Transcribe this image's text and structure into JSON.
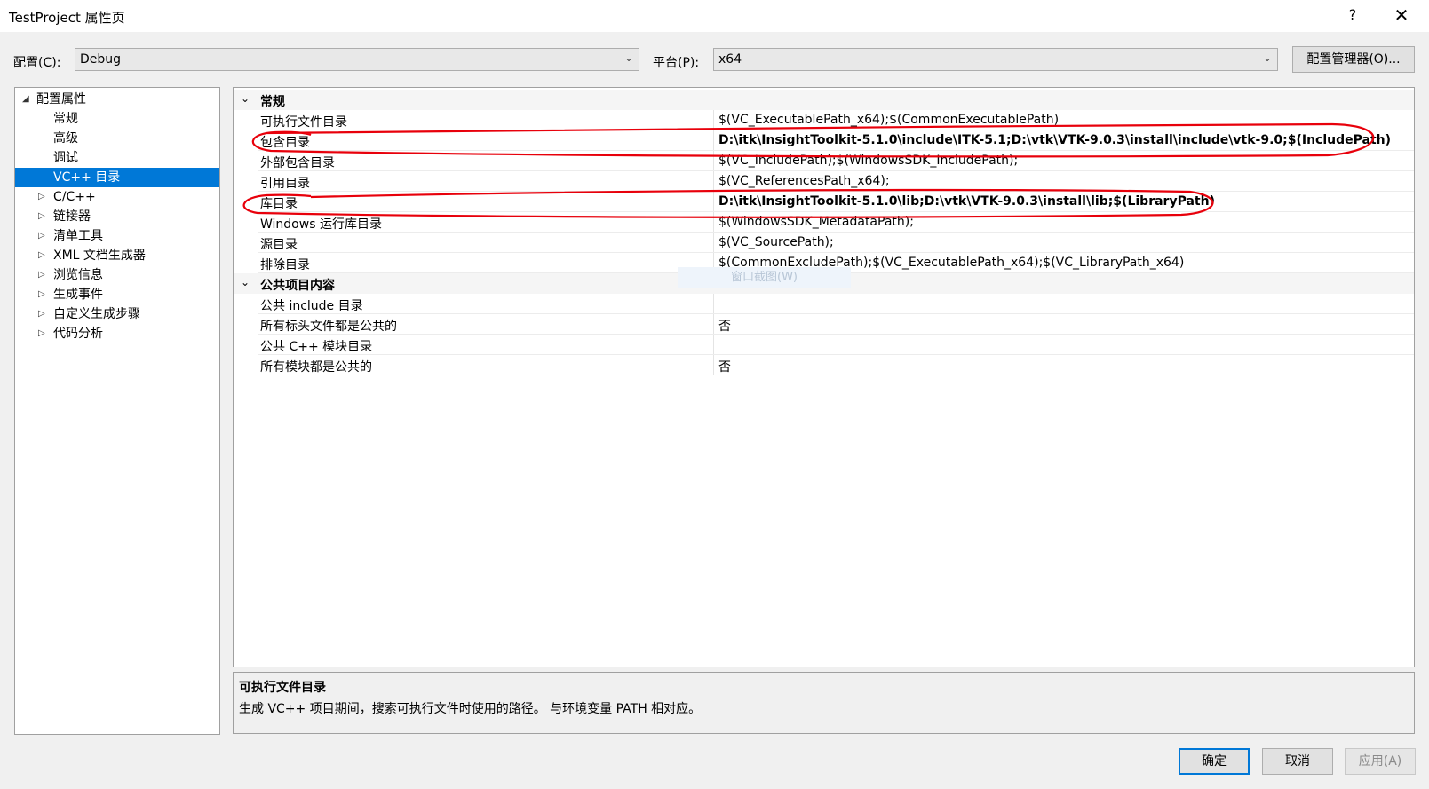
{
  "window": {
    "title": "TestProject 属性页",
    "help": "?",
    "close": "✕"
  },
  "config": {
    "config_label": "配置(C):",
    "config_value": "Debug",
    "platform_label": "平台(P):",
    "platform_value": "x64",
    "manager_button": "配置管理器(O)..."
  },
  "tree": {
    "root": "配置属性",
    "items": [
      "常规",
      "高级",
      "调试",
      "VC++ 目录",
      "C/C++",
      "链接器",
      "清单工具",
      "XML 文档生成器",
      "浏览信息",
      "生成事件",
      "自定义生成步骤",
      "代码分析"
    ],
    "selected": "VC++ 目录"
  },
  "grid": {
    "cat1": "常规",
    "rows1": [
      {
        "name": "可执行文件目录",
        "value": "$(VC_ExecutablePath_x64);$(CommonExecutablePath)"
      },
      {
        "name": "包含目录",
        "value": "D:\\itk\\InsightToolkit-5.1.0\\include\\ITK-5.1;D:\\vtk\\VTK-9.0.3\\install\\include\\vtk-9.0;$(IncludePath)"
      },
      {
        "name": "外部包含目录",
        "value": "$(VC_IncludePath);$(WindowsSDK_IncludePath);"
      },
      {
        "name": "引用目录",
        "value": "$(VC_ReferencesPath_x64);"
      },
      {
        "name": "库目录",
        "value": "D:\\itk\\InsightToolkit-5.1.0\\lib;D:\\vtk\\VTK-9.0.3\\install\\lib;$(LibraryPath)"
      },
      {
        "name": "Windows 运行库目录",
        "value": "$(WindowsSDK_MetadataPath);"
      },
      {
        "name": "源目录",
        "value": "$(VC_SourcePath);"
      },
      {
        "name": "排除目录",
        "value": "$(CommonExcludePath);$(VC_ExecutablePath_x64);$(VC_LibraryPath_x64)"
      }
    ],
    "cat2": "公共项目内容",
    "rows2": [
      {
        "name": "公共 include 目录",
        "value": ""
      },
      {
        "name": "所有标头文件都是公共的",
        "value": "否"
      },
      {
        "name": "公共 C++ 模块目录",
        "value": ""
      },
      {
        "name": "所有模块都是公共的",
        "value": "否"
      }
    ],
    "ghost_text": "窗口截图(W)"
  },
  "description": {
    "title": "可执行文件目录",
    "text": "生成 VC++ 项目期间，搜索可执行文件时使用的路径。 与环境变量 PATH 相对应。"
  },
  "buttons": {
    "ok": "确定",
    "cancel": "取消",
    "apply": "应用(A)"
  },
  "colors": {
    "selection": "#0078d7",
    "annotation": "#e8000b"
  }
}
